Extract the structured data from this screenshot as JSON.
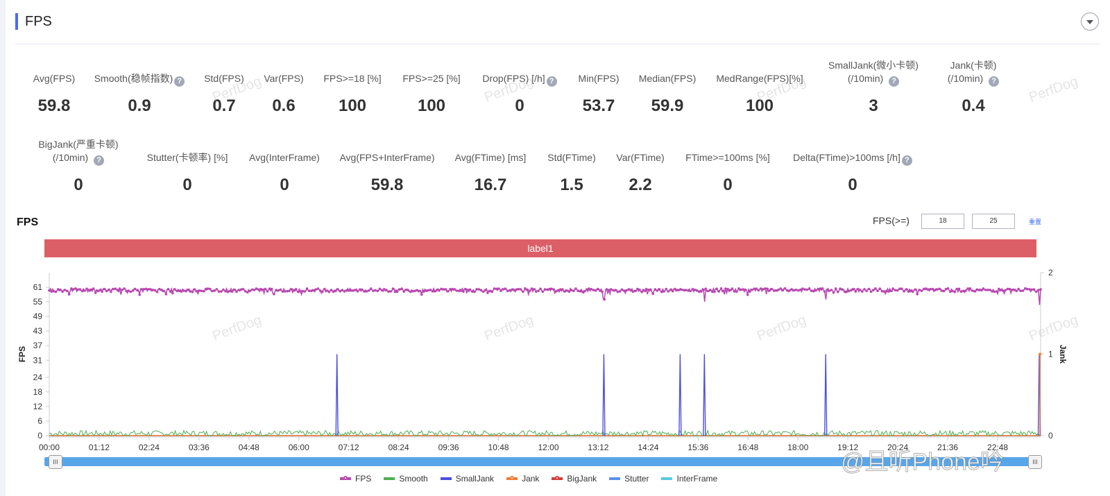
{
  "header": {
    "title": "FPS"
  },
  "metrics_row1": [
    {
      "label": "Avg(FPS)",
      "value": "59.8",
      "help": false
    },
    {
      "label": "Smooth(稳帧指数)",
      "value": "0.9",
      "help": true
    },
    {
      "label": "Std(FPS)",
      "value": "0.7",
      "help": false
    },
    {
      "label": "Var(FPS)",
      "value": "0.6",
      "help": false
    },
    {
      "label": "FPS>=18 [%]",
      "value": "100",
      "help": false
    },
    {
      "label": "FPS>=25 [%]",
      "value": "100",
      "help": false
    },
    {
      "label": "Drop(FPS) [/h]",
      "value": "0",
      "help": true
    },
    {
      "label": "Min(FPS)",
      "value": "53.7",
      "help": false
    },
    {
      "label": "Median(FPS)",
      "value": "59.9",
      "help": false
    },
    {
      "label": "MedRange(FPS)[%]",
      "value": "100",
      "help": false
    },
    {
      "label": "SmallJank(微小卡顿)",
      "label2": "(/10min)",
      "value": "3",
      "help": true
    },
    {
      "label": "Jank(卡顿)",
      "label2": "(/10min)",
      "value": "0.4",
      "help": true
    }
  ],
  "metrics_row2": [
    {
      "label": "BigJank(严重卡顿)",
      "label2": "(/10min)",
      "value": "0",
      "help": true
    },
    {
      "label": "Stutter(卡顿率) [%]",
      "value": "0",
      "help": false
    },
    {
      "label": "Avg(InterFrame)",
      "value": "0",
      "help": false
    },
    {
      "label": "Avg(FPS+InterFrame)",
      "value": "59.8",
      "help": false
    },
    {
      "label": "Avg(FTime) [ms]",
      "value": "16.7",
      "help": false
    },
    {
      "label": "Std(FTime)",
      "value": "1.5",
      "help": false
    },
    {
      "label": "Var(FTime)",
      "value": "2.2",
      "help": false
    },
    {
      "label": "FTime>=100ms [%]",
      "value": "0",
      "help": false
    },
    {
      "label": "Delta(FTime)>100ms [/h]",
      "value": "0",
      "help": true
    }
  ],
  "chart_panel": {
    "title": "FPS",
    "threshold_label": "FPS(>=)",
    "threshold_1": "18",
    "threshold_2": "25",
    "reset_label": "重置",
    "label_band": "label1",
    "help_glyph": "?",
    "slider_handle_glyph": "III",
    "watermark": "PerfDog",
    "weibo_watermark": "@且听Phone吟"
  },
  "chart_data": {
    "type": "line",
    "title": "FPS",
    "xlabel": "",
    "ylabel": "FPS",
    "y2label": "Jank",
    "x_ticks": [
      "00:00",
      "01:12",
      "02:24",
      "03:36",
      "04:48",
      "06:00",
      "07:12",
      "08:24",
      "09:36",
      "10:48",
      "12:00",
      "13:12",
      "14:24",
      "15:36",
      "16:48",
      "18:00",
      "19:12",
      "20:24",
      "21:36",
      "22:48"
    ],
    "x_range_minutes": [
      0,
      1430
    ],
    "y_ticks": [
      0,
      6,
      12,
      18,
      24,
      31,
      37,
      43,
      49,
      55,
      61
    ],
    "ylim": [
      0,
      67
    ],
    "y2_ticks": [
      0,
      1,
      2
    ],
    "y2lim": [
      0,
      2
    ],
    "grid": false,
    "legend_position": "bottom",
    "series": [
      {
        "name": "FPS",
        "color": "#b847b0",
        "axis": "left",
        "style": "line-dots",
        "baseline": 59.8,
        "noise": 0.7,
        "dips": [
          {
            "t": 800,
            "v": 56
          },
          {
            "t": 945,
            "v": 55
          },
          {
            "t": 1120,
            "v": 56
          },
          {
            "t": 1428,
            "v": 53.7
          }
        ]
      },
      {
        "name": "Smooth",
        "color": "#4caf50",
        "axis": "left",
        "style": "line",
        "baseline": 0.9,
        "noise": 1.2
      },
      {
        "name": "SmallJank",
        "color": "#4b4fe0",
        "axis": "right",
        "style": "line",
        "spikes_minutes": [
          415,
          800,
          910,
          945,
          1120,
          1428
        ],
        "spike_value": 1
      },
      {
        "name": "Jank",
        "color": "#f07c32",
        "axis": "right",
        "style": "line-dots",
        "spikes_minutes": [
          1428
        ],
        "spike_value": 1
      },
      {
        "name": "BigJank",
        "color": "#d23c3c",
        "axis": "right",
        "style": "line-dots",
        "values_constant": 0
      },
      {
        "name": "Stutter",
        "color": "#5b8ff0",
        "axis": "right",
        "style": "line",
        "values_constant": 0
      },
      {
        "name": "InterFrame",
        "color": "#5bc8e0",
        "axis": "left",
        "style": "line",
        "values_constant": 0
      }
    ]
  }
}
